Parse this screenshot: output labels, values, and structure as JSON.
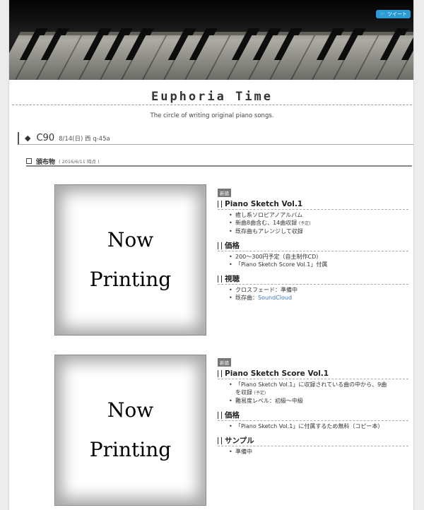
{
  "header": {
    "tweet_label": "ツイート",
    "site_title": "Euphoria Time",
    "tagline": "The circle of writing original piano songs."
  },
  "event": {
    "name": "C90",
    "detail": "8/14(日) 西 q-45a"
  },
  "distribution": {
    "label": "頒布物",
    "date": "( 2016/6/11 時点 )"
  },
  "products": [
    {
      "cover_line1": "Now",
      "cover_line2": "Printing",
      "badge": "新譜",
      "title": "Piano Sketch Vol.1",
      "features": [
        "癒し系ソロピアノアルバム",
        "新曲8曲含む、14曲収録",
        "既存曲もアレンジして収録"
      ],
      "features_note": "(予定)",
      "price_heading": "価格",
      "prices": [
        "200〜300円予定（自主制作CD）",
        "「Piano Sketch Score Vol.1」付属"
      ],
      "extra_heading": "視聴",
      "extra_items": [
        "クロスフェード：準備中",
        "既存曲："
      ],
      "extra_link": "SoundCloud"
    },
    {
      "cover_line1": "Now",
      "cover_line2": "Printing",
      "badge": "新譜",
      "title": "Piano Sketch Score Vol.1",
      "features": [
        "「Piano Sketch Vol.1」に収録されている曲の中から、9曲",
        "を収録",
        "難易度レベル：初級〜中級"
      ],
      "features_note": "(予定)",
      "price_heading": "価格",
      "prices": [
        "「Piano Sketch Vol.1」に付属するため無料（コピー本）"
      ],
      "extra_heading": "サンプル",
      "extra_items": [
        "準備中"
      ]
    }
  ],
  "icons": [
    "twitter-bird-icon",
    "diamond-icon",
    "checkbox-icon"
  ]
}
